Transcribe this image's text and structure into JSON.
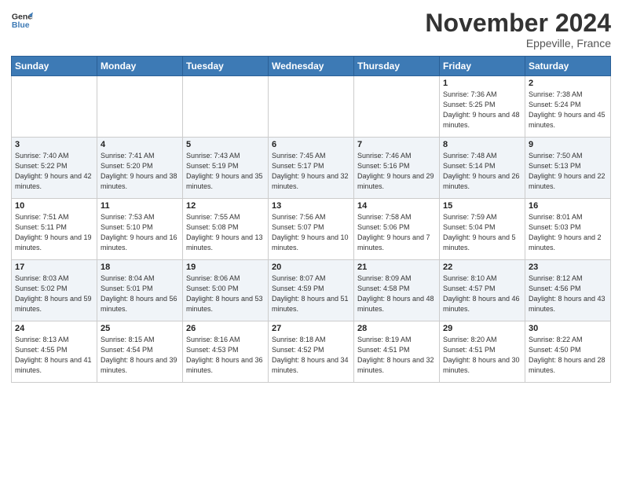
{
  "logo": {
    "line1": "General",
    "line2": "Blue"
  },
  "title": "November 2024",
  "location": "Eppeville, France",
  "days_header": [
    "Sunday",
    "Monday",
    "Tuesday",
    "Wednesday",
    "Thursday",
    "Friday",
    "Saturday"
  ],
  "weeks": [
    [
      {
        "day": "",
        "info": ""
      },
      {
        "day": "",
        "info": ""
      },
      {
        "day": "",
        "info": ""
      },
      {
        "day": "",
        "info": ""
      },
      {
        "day": "",
        "info": ""
      },
      {
        "day": "1",
        "info": "Sunrise: 7:36 AM\nSunset: 5:25 PM\nDaylight: 9 hours and 48 minutes."
      },
      {
        "day": "2",
        "info": "Sunrise: 7:38 AM\nSunset: 5:24 PM\nDaylight: 9 hours and 45 minutes."
      }
    ],
    [
      {
        "day": "3",
        "info": "Sunrise: 7:40 AM\nSunset: 5:22 PM\nDaylight: 9 hours and 42 minutes."
      },
      {
        "day": "4",
        "info": "Sunrise: 7:41 AM\nSunset: 5:20 PM\nDaylight: 9 hours and 38 minutes."
      },
      {
        "day": "5",
        "info": "Sunrise: 7:43 AM\nSunset: 5:19 PM\nDaylight: 9 hours and 35 minutes."
      },
      {
        "day": "6",
        "info": "Sunrise: 7:45 AM\nSunset: 5:17 PM\nDaylight: 9 hours and 32 minutes."
      },
      {
        "day": "7",
        "info": "Sunrise: 7:46 AM\nSunset: 5:16 PM\nDaylight: 9 hours and 29 minutes."
      },
      {
        "day": "8",
        "info": "Sunrise: 7:48 AM\nSunset: 5:14 PM\nDaylight: 9 hours and 26 minutes."
      },
      {
        "day": "9",
        "info": "Sunrise: 7:50 AM\nSunset: 5:13 PM\nDaylight: 9 hours and 22 minutes."
      }
    ],
    [
      {
        "day": "10",
        "info": "Sunrise: 7:51 AM\nSunset: 5:11 PM\nDaylight: 9 hours and 19 minutes."
      },
      {
        "day": "11",
        "info": "Sunrise: 7:53 AM\nSunset: 5:10 PM\nDaylight: 9 hours and 16 minutes."
      },
      {
        "day": "12",
        "info": "Sunrise: 7:55 AM\nSunset: 5:08 PM\nDaylight: 9 hours and 13 minutes."
      },
      {
        "day": "13",
        "info": "Sunrise: 7:56 AM\nSunset: 5:07 PM\nDaylight: 9 hours and 10 minutes."
      },
      {
        "day": "14",
        "info": "Sunrise: 7:58 AM\nSunset: 5:06 PM\nDaylight: 9 hours and 7 minutes."
      },
      {
        "day": "15",
        "info": "Sunrise: 7:59 AM\nSunset: 5:04 PM\nDaylight: 9 hours and 5 minutes."
      },
      {
        "day": "16",
        "info": "Sunrise: 8:01 AM\nSunset: 5:03 PM\nDaylight: 9 hours and 2 minutes."
      }
    ],
    [
      {
        "day": "17",
        "info": "Sunrise: 8:03 AM\nSunset: 5:02 PM\nDaylight: 8 hours and 59 minutes."
      },
      {
        "day": "18",
        "info": "Sunrise: 8:04 AM\nSunset: 5:01 PM\nDaylight: 8 hours and 56 minutes."
      },
      {
        "day": "19",
        "info": "Sunrise: 8:06 AM\nSunset: 5:00 PM\nDaylight: 8 hours and 53 minutes."
      },
      {
        "day": "20",
        "info": "Sunrise: 8:07 AM\nSunset: 4:59 PM\nDaylight: 8 hours and 51 minutes."
      },
      {
        "day": "21",
        "info": "Sunrise: 8:09 AM\nSunset: 4:58 PM\nDaylight: 8 hours and 48 minutes."
      },
      {
        "day": "22",
        "info": "Sunrise: 8:10 AM\nSunset: 4:57 PM\nDaylight: 8 hours and 46 minutes."
      },
      {
        "day": "23",
        "info": "Sunrise: 8:12 AM\nSunset: 4:56 PM\nDaylight: 8 hours and 43 minutes."
      }
    ],
    [
      {
        "day": "24",
        "info": "Sunrise: 8:13 AM\nSunset: 4:55 PM\nDaylight: 8 hours and 41 minutes."
      },
      {
        "day": "25",
        "info": "Sunrise: 8:15 AM\nSunset: 4:54 PM\nDaylight: 8 hours and 39 minutes."
      },
      {
        "day": "26",
        "info": "Sunrise: 8:16 AM\nSunset: 4:53 PM\nDaylight: 8 hours and 36 minutes."
      },
      {
        "day": "27",
        "info": "Sunrise: 8:18 AM\nSunset: 4:52 PM\nDaylight: 8 hours and 34 minutes."
      },
      {
        "day": "28",
        "info": "Sunrise: 8:19 AM\nSunset: 4:51 PM\nDaylight: 8 hours and 32 minutes."
      },
      {
        "day": "29",
        "info": "Sunrise: 8:20 AM\nSunset: 4:51 PM\nDaylight: 8 hours and 30 minutes."
      },
      {
        "day": "30",
        "info": "Sunrise: 8:22 AM\nSunset: 4:50 PM\nDaylight: 8 hours and 28 minutes."
      }
    ]
  ]
}
